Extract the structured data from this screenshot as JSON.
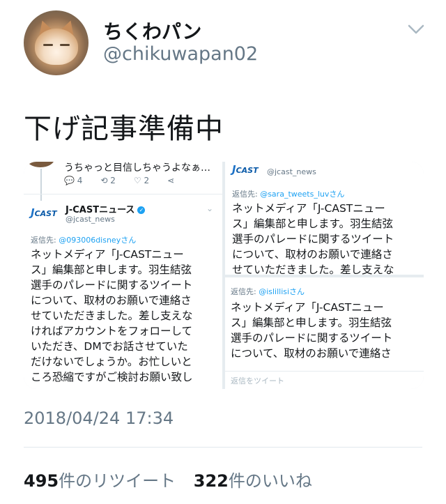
{
  "user": {
    "display_name": "ちくわパン",
    "handle": "@chikuwapan02"
  },
  "tweet": {
    "text": "下げ記事準備中",
    "timestamp": "2018/04/24 17:34"
  },
  "stats": {
    "retweets_count": "495",
    "retweets_label": "件のリツイート",
    "likes_count": "322",
    "likes_label": "件のいいね"
  },
  "screenshot_left": {
    "cut_text": "うちゃっと目信しちゃうよなぁ…",
    "actions": [
      "4",
      "2",
      "2"
    ],
    "account_name": "J-CASTニュース",
    "account_handle": "@jcast_news",
    "reply_prefix": "返信先: ",
    "reply_mention": "@093006disneyさん",
    "lines": [
      "ネットメディア「J-CASTニュー",
      "ス」編集部と申します。羽生結弦",
      "選手のパレードに関するツイート",
      "について、取材のお願いで連絡さ",
      "せていただきました。差し支えな",
      "ければアカウントをフォローして",
      "いただき、DMでお話させていた",
      "だけないでしょうか。お忙しいと",
      "ころ恐縮ですがご検討お願い致し"
    ]
  },
  "screenshot_right_top": {
    "account_handle": "@jcast_news",
    "reply_prefix": "返信先: ",
    "reply_mention": "@sara_tweets_luvさん",
    "lines": [
      "ネットメディア「J-CASTニュー",
      "ス」編集部と申します。羽生結弦",
      "選手のパレードに関するツイート",
      "について、取材のお願いで連絡さ",
      "せていただきました。差し支えな"
    ]
  },
  "screenshot_right_bottom": {
    "reply_prefix": "返信先: ",
    "reply_mention": "@islillisiさん",
    "lines": [
      "ネットメディア「J-CASTニュー",
      "ス」編集部と申します。羽生結弦",
      "選手のパレードに関するツイート",
      "について、取材のお願いで連絡さ"
    ],
    "reply_bar": "返信をツイート"
  },
  "logo_text": "CAST",
  "colors": {
    "link": "#1da1f2",
    "muted": "#657786",
    "text": "#14171a"
  }
}
